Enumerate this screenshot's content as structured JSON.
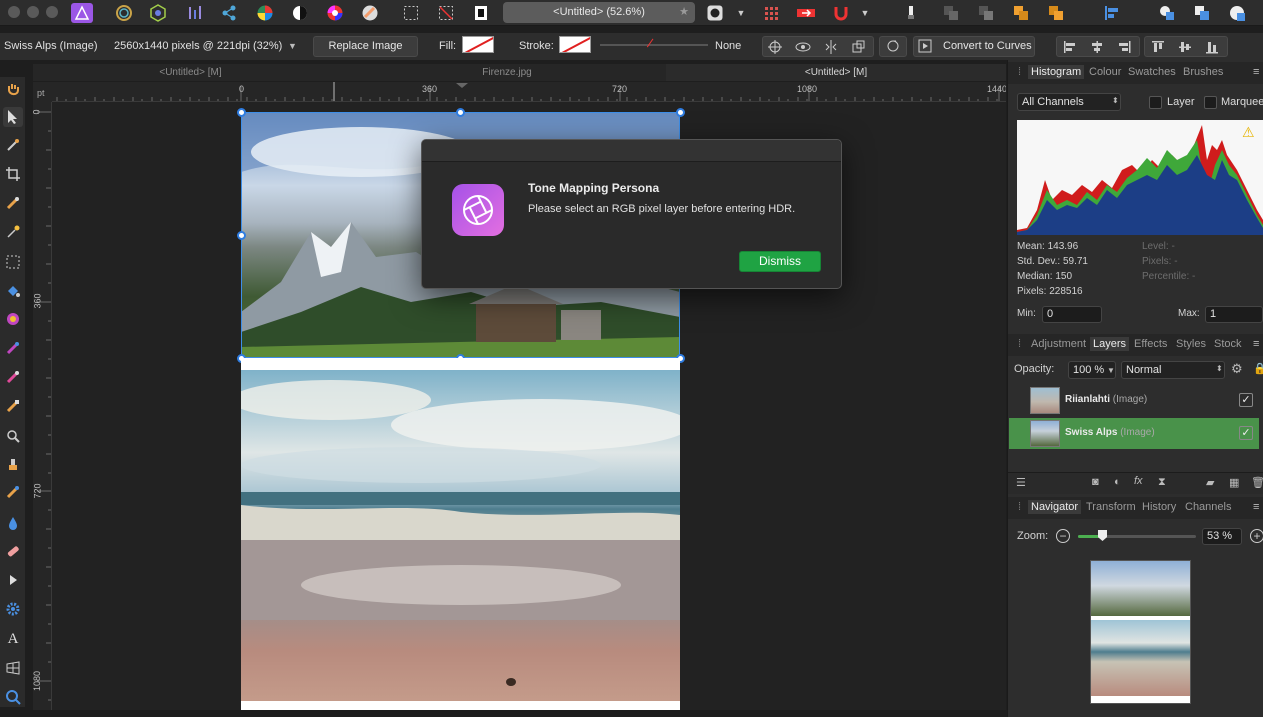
{
  "toolbar": {
    "document_title": "<Untitled> (52.6%)",
    "star": "★",
    "icons": [
      "designer-persona-icon",
      "liquify-persona-icon",
      "develop-persona-icon",
      "tone-mapping-persona-icon",
      "export-persona-icon",
      "color-wheel-icon",
      "contrast-icon",
      "hsl-icon",
      "gradient-icon",
      "marquee-select-icon",
      "no-selection-icon",
      "snapping-icon",
      "quick-mask-icon",
      "assistant-icon",
      "order-icon",
      "magnet-icon",
      "brush-icon",
      "arrange-icon",
      "align-icon",
      "boolean-icon"
    ]
  },
  "context": {
    "layer_label": "Swiss Alps (Image)",
    "dimensions": "2560x1440 pixels @ 221dpi (32%)",
    "replace_image": "Replace Image",
    "fill_label": "Fill:",
    "stroke_label": "Stroke:",
    "stroke_value": "None",
    "convert_to_curves": "Convert to Curves"
  },
  "tabs": [
    {
      "label": "<Untitled> [M]",
      "active": false
    },
    {
      "label": "Firenze.jpg",
      "active": false
    },
    {
      "label": "<Untitled> [M]",
      "active": true
    }
  ],
  "ruler": {
    "unit": "pt",
    "h_labels": [
      "0",
      "360",
      "720",
      "1080",
      "1440"
    ],
    "v_labels": [
      "0",
      "360",
      "720",
      "1080"
    ]
  },
  "dialog": {
    "title": "Tone Mapping Persona",
    "message": "Please select an RGB pixel layer before entering HDR.",
    "dismiss": "Dismiss"
  },
  "histogram": {
    "tabs": [
      "Histogram",
      "Colour",
      "Swatches",
      "Brushes"
    ],
    "channel": "All Channels",
    "layer_label": "Layer",
    "marquee_label": "Marquee",
    "warning": "⚠",
    "mean": "Mean: 143.96",
    "std_dev": "Std. Dev.: 59.71",
    "median": "Median: 150",
    "pixels": "Pixels: 228516",
    "level": "Level: -",
    "pixels_sel": "Pixels: -",
    "percentile": "Percentile: -",
    "min_label": "Min:",
    "min_value": "0",
    "max_label": "Max:",
    "max_value": "1"
  },
  "layers_panel": {
    "tabs": [
      "Adjustment",
      "Layers",
      "Effects",
      "Styles",
      "Stock"
    ],
    "opacity_label": "Opacity:",
    "opacity_value": "100 %",
    "blend_mode": "Normal",
    "layers": [
      {
        "name": "Riianlahti",
        "type": "(Image)",
        "selected": false,
        "visible": "✓"
      },
      {
        "name": "Swiss Alps",
        "type": "(Image)",
        "selected": true,
        "visible": "✓"
      }
    ]
  },
  "navigator": {
    "tabs": [
      "Navigator",
      "Transform",
      "History",
      "Channels"
    ],
    "zoom_label": "Zoom:",
    "zoom_value": "53 %"
  },
  "colors": {
    "accent": "#2f7de1",
    "dismiss": "#1fa343",
    "selected_layer": "#49924a"
  }
}
